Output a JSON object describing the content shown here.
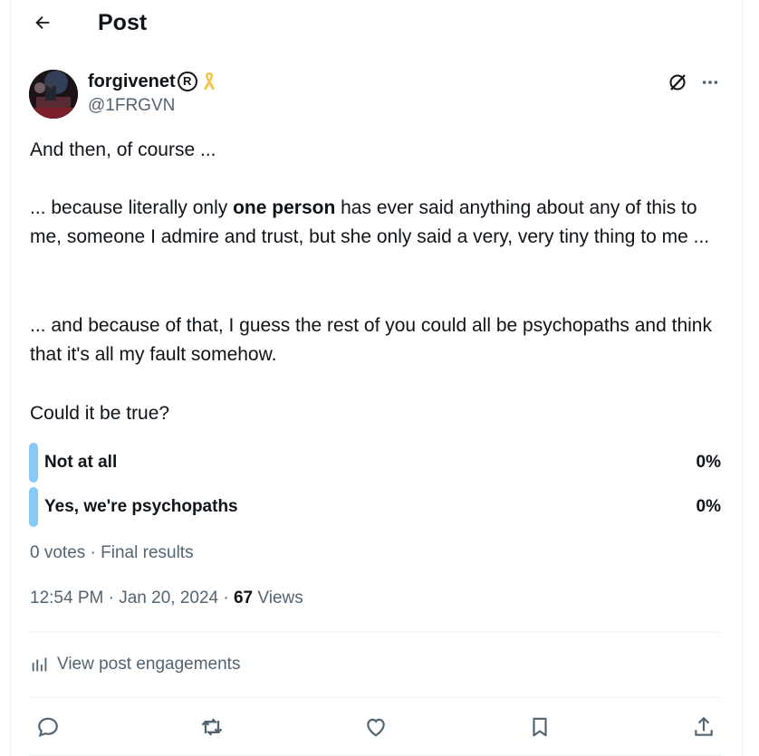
{
  "header": {
    "title": "Post",
    "back_icon": "back-arrow-icon"
  },
  "author": {
    "name": "forgivenet",
    "reg_mark": "R",
    "badge_icon": "ribbon-icon",
    "badge_color": "#f5c242",
    "handle": "@1FRGVN"
  },
  "post": {
    "p1": "And then, of course ...",
    "p2_a": "... because literally only ",
    "p2_bold": "one person",
    "p2_b": " has ever said anything about any of this to me, someone I admire and trust, but she only said a very, very tiny thing to me ...",
    "p3": "... and because of that, I guess the rest of you could all be psychopaths and think that it's all my fault somehow.",
    "p4": "Could it be true?"
  },
  "poll": {
    "bar_color": "#88c9f7",
    "options": [
      {
        "label": "Not at all",
        "percent": "0%"
      },
      {
        "label": "Yes, we're psychopaths",
        "percent": "0%"
      }
    ],
    "votes": "0 votes",
    "sep": " · ",
    "status": "Final results"
  },
  "meta": {
    "time": "12:54 PM",
    "sep": " · ",
    "date": "Jan 20, 2024",
    "views_count": "67",
    "views_label": " Views"
  },
  "engagements": {
    "label": "View post engagements",
    "icon": "analytics-icon"
  },
  "actions": [
    "reply-icon",
    "repost-icon",
    "like-icon",
    "bookmark-icon",
    "share-icon"
  ],
  "colors": {
    "text": "#0f1419",
    "secondary": "#536471",
    "divider": "#eff3f4"
  }
}
